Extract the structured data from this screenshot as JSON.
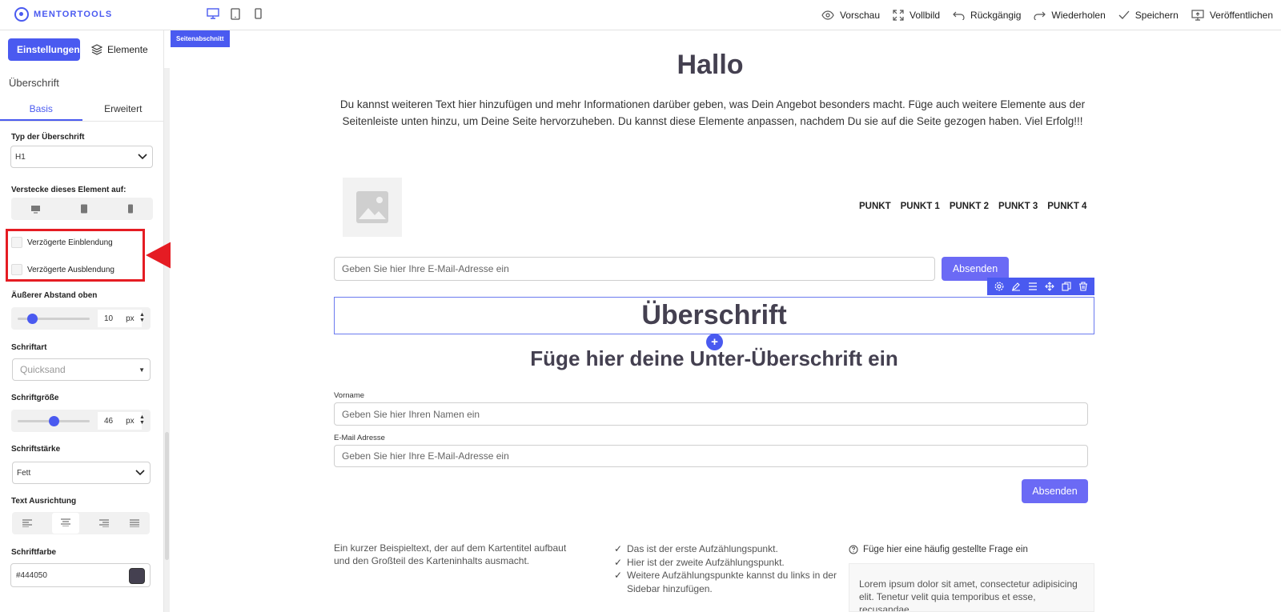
{
  "app": {
    "logo_text": "MENTORTOOLS"
  },
  "topbar": {
    "devices": [
      "desktop-icon",
      "tablet-icon",
      "phone-icon"
    ],
    "actions": [
      {
        "icon": "eye-icon",
        "label": "Vorschau"
      },
      {
        "icon": "fullscreen-icon",
        "label": "Vollbild"
      },
      {
        "icon": "undo-icon",
        "label": "Rückgängig"
      },
      {
        "icon": "redo-icon",
        "label": "Wiederholen"
      },
      {
        "icon": "check-icon",
        "label": "Speichern"
      },
      {
        "icon": "publish-icon",
        "label": "Veröffentlichen"
      }
    ]
  },
  "sidebar": {
    "settings_label": "Einstellungen",
    "elements_label": "Elemente",
    "title": "Überschrift",
    "tabs": [
      "Basis",
      "Erweitert"
    ],
    "heading_type_label": "Typ der Überschrift",
    "heading_type_value": "H1",
    "hide_label": "Verstecke dieses Element auf:",
    "delayed_in": "Verzögerte Einblendung",
    "delayed_out": "Verzögerte Ausblendung",
    "margin_top_label": "Äußerer Abstand oben",
    "margin_top_value": "10",
    "unit": "px",
    "font_label": "Schriftart",
    "font_value": "Quicksand",
    "font_size_label": "Schriftgröße",
    "font_size_value": "46",
    "font_weight_label": "Schriftstärke",
    "font_weight_value": "Fett",
    "align_label": "Text Ausrichtung",
    "color_label": "Schriftfarbe",
    "color_value": "#444050"
  },
  "canvas": {
    "section_tag": "Seitenabschnitt",
    "hallo": "Hallo",
    "intro": "Du kannst weiteren Text hier hinzufügen und mehr Informationen darüber geben, was Dein Angebot besonders macht. Füge auch weitere Elemente aus der Seitenleiste unten hinzu, um Deine Seite hervorzuheben. Du kannst diese Elemente anpassen, nachdem Du sie auf die Seite gezogen haben. Viel Erfolg!!!",
    "menu": [
      "PUNKT",
      "PUNKT 1",
      "PUNKT 2",
      "PUNKT 3",
      "PUNKT 4"
    ],
    "email_placeholder": "Geben Sie hier Ihre E-Mail-Adresse ein",
    "send_label": "Absenden",
    "heading": "Überschrift",
    "subheading": "Füge hier deine Unter-Überschrift ein",
    "firstname_label": "Vorname",
    "firstname_placeholder": "Geben Sie hier Ihren Namen ein",
    "email_label": "E-Mail Adresse",
    "card_text": "Ein kurzer Beispieltext, der auf dem Kartentitel aufbaut und den Großteil des Karteninhalts ausmacht.",
    "bullets": [
      "Das ist der erste Aufzählungspunkt.",
      "Hier ist der zweite Aufzählungspunkt.",
      "Weitere Aufzählungspunkte kannst du links in der Sidebar hinzufügen."
    ],
    "faq_question": "Füge hier eine häufig gestellte Frage ein",
    "faq_answer": "Lorem ipsum dolor sit amet, consectetur adipisicing elit. Tenetur velit quia temporibus et esse, recusandae."
  },
  "colors": {
    "accent": "#4a5af0",
    "button": "#6b6af5",
    "heading": "#444050",
    "highlight": "#e51c23"
  },
  "sliders": {
    "margin_top_fraction": 0.15,
    "font_size_fraction": 0.5
  }
}
